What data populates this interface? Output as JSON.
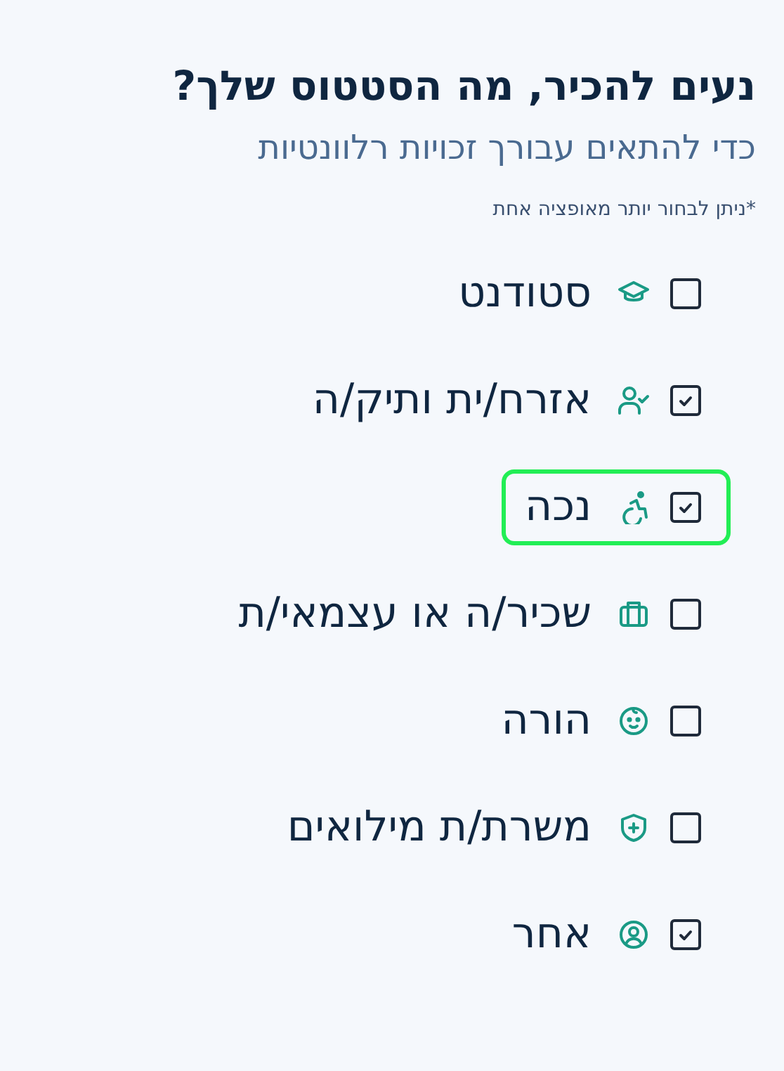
{
  "title": "נעים להכיר, מה הסטטוס שלך?",
  "subtitle": "כדי להתאים עבורך זכויות רלוונטיות",
  "note": "*ניתן לבחור יותר מאופציה אחת",
  "options": [
    {
      "label": "סטודנט",
      "checked": false,
      "focused": false
    },
    {
      "label": "אזרח/ית ותיק/ה",
      "checked": true,
      "focused": false
    },
    {
      "label": "נכה",
      "checked": true,
      "focused": true
    },
    {
      "label": "שכיר/ה או עצמאי/ת",
      "checked": false,
      "focused": false
    },
    {
      "label": "הורה",
      "checked": false,
      "focused": false
    },
    {
      "label": "משרת/ת מילואים",
      "checked": false,
      "focused": false
    },
    {
      "label": "אחר",
      "checked": true,
      "focused": false
    }
  ]
}
